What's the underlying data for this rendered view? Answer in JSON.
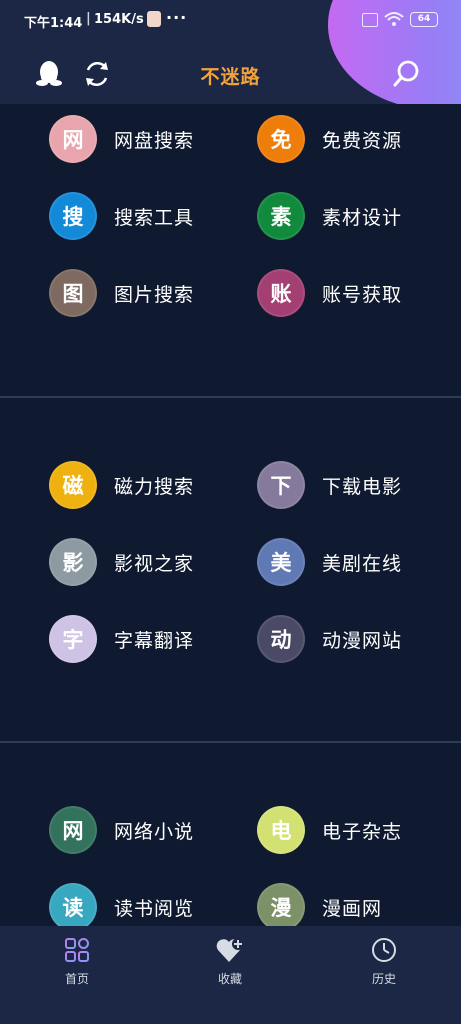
{
  "status_bar": {
    "time": "下午1:44",
    "speed": "154K/s",
    "dots": "···",
    "battery": "64"
  },
  "header": {
    "title": "不迷路"
  },
  "sections": [
    {
      "items": [
        {
          "char": "网",
          "label": "网盘搜索",
          "color": "#e9a5ad"
        },
        {
          "char": "免",
          "label": "免费资源",
          "color": "#ef7d0a"
        },
        {
          "char": "搜",
          "label": "搜索工具",
          "color": "#138ad8"
        },
        {
          "char": "素",
          "label": "素材设计",
          "color": "#118a3e"
        },
        {
          "char": "图",
          "label": "图片搜索",
          "color": "#7e6a60"
        },
        {
          "char": "账",
          "label": "账号获取",
          "color": "#a43f74"
        }
      ]
    },
    {
      "items": [
        {
          "char": "磁",
          "label": "磁力搜索",
          "color": "#efb10f"
        },
        {
          "char": "下",
          "label": "下载电影",
          "color": "#857a9c"
        },
        {
          "char": "影",
          "label": "影视之家",
          "color": "#8d9aa2"
        },
        {
          "char": "美",
          "label": "美剧在线",
          "color": "#5f79b4"
        },
        {
          "char": "字",
          "label": "字幕翻译",
          "color": "#cfc3e5"
        },
        {
          "char": "动",
          "label": "动漫网站",
          "color": "#4a4a66"
        }
      ]
    },
    {
      "items": [
        {
          "char": "网",
          "label": "网络小说",
          "color": "#33725d"
        },
        {
          "char": "电",
          "label": "电子杂志",
          "color": "#d3e173"
        },
        {
          "char": "读",
          "label": "读书阅览",
          "color": "#38a8c0"
        },
        {
          "char": "漫",
          "label": "漫画网",
          "color": "#7d9168"
        }
      ]
    }
  ],
  "bottom_nav": [
    {
      "label": "首页",
      "icon": "home-grid-icon",
      "active": true
    },
    {
      "label": "收藏",
      "icon": "heart-plus-icon",
      "active": false
    },
    {
      "label": "历史",
      "icon": "clock-icon",
      "active": false
    }
  ]
}
